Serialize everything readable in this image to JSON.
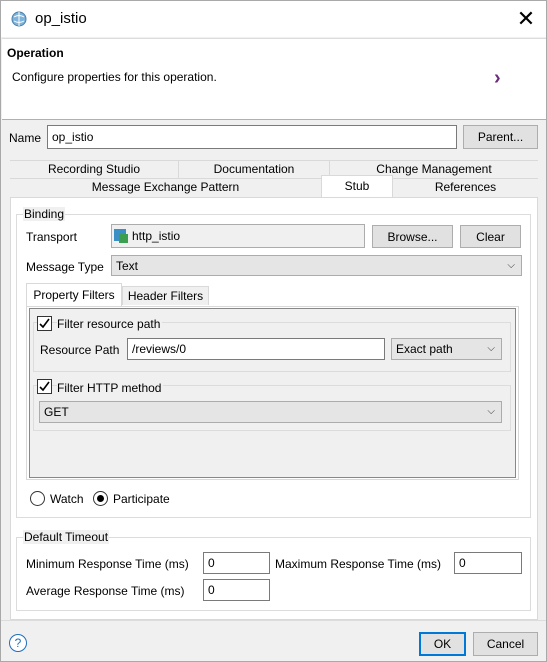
{
  "window": {
    "title": "op_istio"
  },
  "header": {
    "title": "Operation",
    "description": "Configure properties for this operation."
  },
  "name_row": {
    "label": "Name",
    "value": "op_istio",
    "parent_button": "Parent..."
  },
  "tabs_row1": [
    "Recording Studio",
    "Documentation",
    "Change Management"
  ],
  "tabs_row2": [
    "Message Exchange Pattern",
    "Stub",
    "References"
  ],
  "active_tab": "Stub",
  "binding": {
    "group_label": "Binding",
    "transport_label": "Transport",
    "transport_value": "http_istio",
    "browse_button": "Browse...",
    "clear_button": "Clear",
    "message_type_label": "Message Type",
    "message_type_value": "Text"
  },
  "inner_tabs": [
    "Property Filters",
    "Header Filters"
  ],
  "active_inner_tab": "Property Filters",
  "filters": {
    "filter_resource_path_label": "Filter resource path",
    "filter_resource_path_checked": true,
    "resource_path_label": "Resource Path",
    "resource_path_value": "/reviews/0",
    "match_mode": "Exact path",
    "filter_http_method_label": "Filter HTTP method",
    "filter_http_method_checked": true,
    "http_method": "GET"
  },
  "mode": {
    "options": [
      "Watch",
      "Participate"
    ],
    "selected": "Participate"
  },
  "timeout": {
    "group_label": "Default Timeout",
    "min_label": "Minimum Response Time (ms)",
    "min_value": "0",
    "max_label": "Maximum Response Time (ms)",
    "max_value": "0",
    "avg_label": "Average Response Time (ms)",
    "avg_value": "0"
  },
  "footer": {
    "ok_button": "OK",
    "cancel_button": "Cancel",
    "help_icon": "?"
  },
  "colors": {
    "accent": "#0078d7",
    "arrow": "#6b2c7a"
  }
}
